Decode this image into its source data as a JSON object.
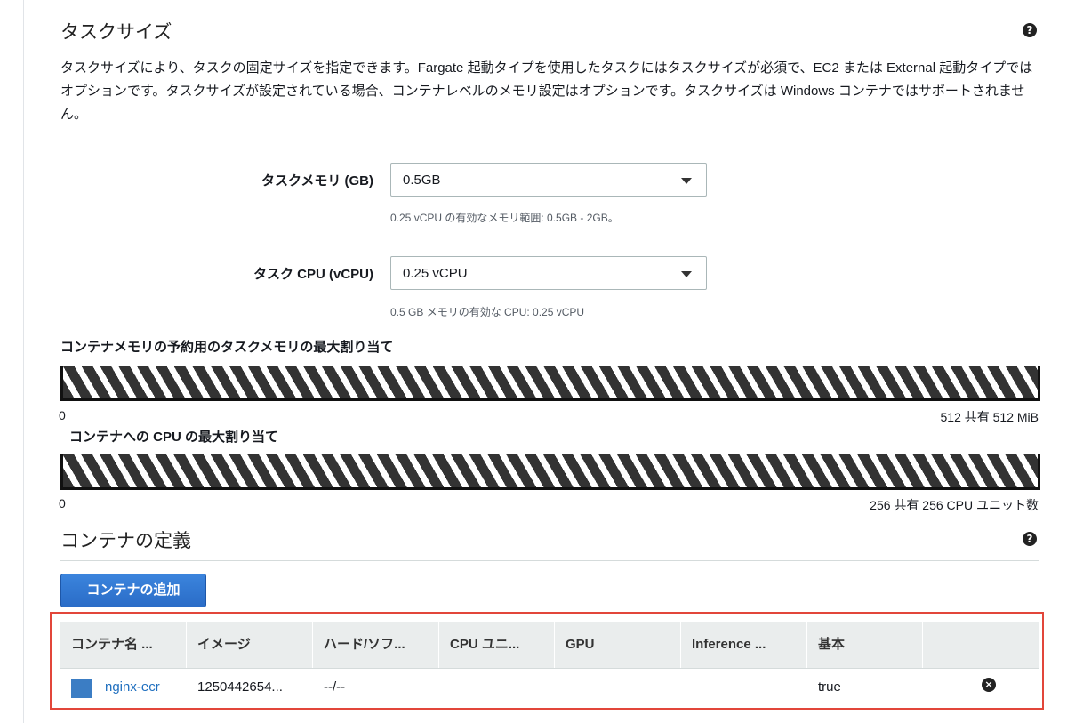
{
  "task_size": {
    "title": "タスクサイズ",
    "help_glyph": "?",
    "description": "タスクサイズにより、タスクの固定サイズを指定できます。Fargate 起動タイプを使用したタスクにはタスクサイズが必須で、EC2 または External 起動タイプではオプションです。タスクサイズが設定されている場合、コンテナレベルのメモリ設定はオプションです。タスクサイズは Windows コンテナではサポートされません。",
    "memory": {
      "label": "タスクメモリ (GB)",
      "value": "0.5GB",
      "hint": "0.25 vCPU の有効なメモリ範囲: 0.5GB - 2GB。"
    },
    "cpu": {
      "label": "タスク CPU (vCPU)",
      "value": "0.25 vCPU",
      "hint": "0.5 GB メモリの有効な CPU: 0.25 vCPU"
    }
  },
  "memory_allocation": {
    "title": "コンテナメモリの予約用のタスクメモリの最大割り当て",
    "min": "0",
    "max": "512 共有 512 MiB"
  },
  "cpu_allocation": {
    "title": "コンテナへの CPU の最大割り当て",
    "min": "0",
    "max": "256 共有 256 CPU ユニット数"
  },
  "container_definitions": {
    "title": "コンテナの定義",
    "help_glyph": "?",
    "add_button": "コンテナの追加",
    "columns": [
      "コンテナ名 ...",
      "イメージ",
      "ハード/ソフ...",
      "CPU ユニ...",
      "GPU",
      "Inference ...",
      "基本",
      ""
    ],
    "rows": [
      {
        "name": "nginx-ecr",
        "image": "1250442654...",
        "memory_limits": "--/--",
        "cpu_units": "",
        "gpu": "",
        "inference": "",
        "essential": "true",
        "swatch_color": "#3b7dc4"
      }
    ],
    "remove_glyph": "×"
  },
  "colors": {
    "accent_blue": "#2a6cc7",
    "link": "#1f6fbf",
    "highlight_border": "#e2463a"
  }
}
